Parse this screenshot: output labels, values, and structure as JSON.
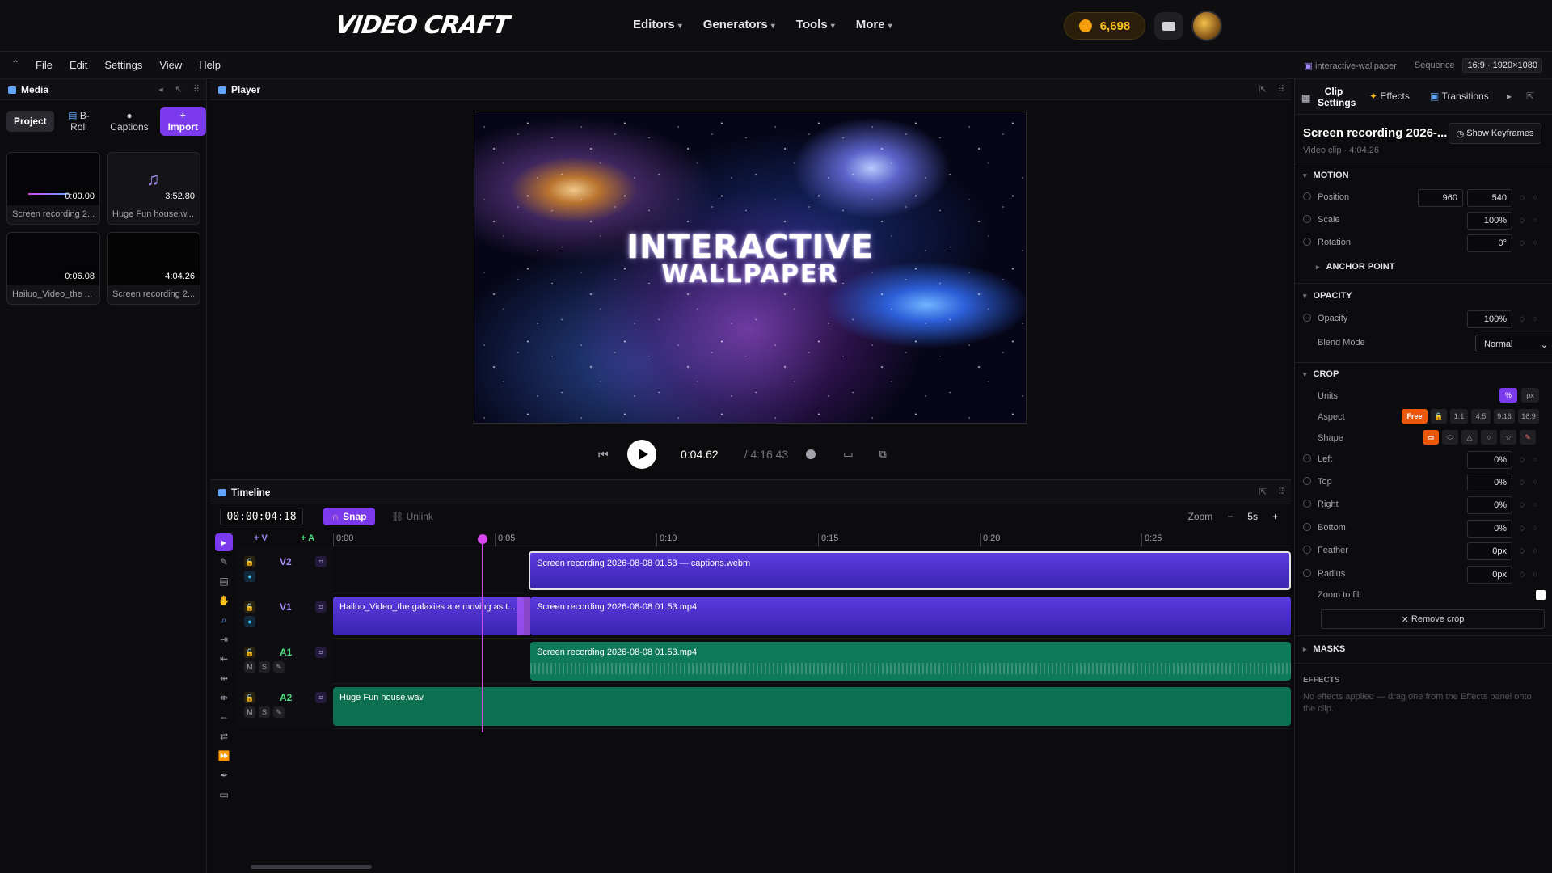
{
  "app": {
    "logo": "VIDEO CRAFT"
  },
  "topnav": [
    {
      "label": "Editors"
    },
    {
      "label": "Generators"
    },
    {
      "label": "Tools"
    },
    {
      "label": "More"
    }
  ],
  "coins": "6,698",
  "menubar": {
    "items": [
      "File",
      "Edit",
      "Settings",
      "View",
      "Help"
    ],
    "project": "interactive-wallpaper",
    "sequence_label": "Sequence",
    "sequence_value": "16:9 · 1920×1080"
  },
  "media": {
    "title": "Media",
    "tabs": {
      "project": "Project",
      "broll": "B-Roll",
      "captions": "Captions",
      "import": "Import"
    },
    "items": [
      {
        "name": "Screen recording 2...",
        "dur": "0:00.00"
      },
      {
        "name": "Huge Fun house.w...",
        "dur": "3:52.80"
      },
      {
        "name": "Hailuo_Video_the ...",
        "dur": "0:06.08"
      },
      {
        "name": "Screen recording 2...",
        "dur": "4:04.26"
      }
    ]
  },
  "player": {
    "title": "Player",
    "frame_line1": "INTERACTIVE",
    "frame_line2": "WALLPAPER",
    "current": "0:04.62",
    "total": "/ 4:16.43"
  },
  "timeline": {
    "title": "Timeline",
    "timecode": "00:00:04:18",
    "snap": "Snap",
    "unlink": "Unlink",
    "zoom_label": "Zoom",
    "zoom_minus": "−",
    "zoom_value": "5s",
    "zoom_plus": "+",
    "addv": "+ V",
    "adda": "+ A",
    "ruler": [
      "0:00",
      "0:05",
      "0:10",
      "0:15",
      "0:20",
      "0:25"
    ],
    "tracks": [
      {
        "name": "V2",
        "type": "video"
      },
      {
        "name": "V1",
        "type": "video"
      },
      {
        "name": "A1",
        "type": "audio"
      },
      {
        "name": "A2",
        "type": "audio"
      }
    ],
    "clips": {
      "v2": "Screen recording 2026-08-08 01.53 — captions.webm",
      "v1a": "Hailuo_Video_the galaxies are moving as t...",
      "v1b": "Screen recording 2026-08-08 01.53.mp4",
      "a1": "Screen recording 2026-08-08 01.53.mp4",
      "a2": "Huge Fun house.wav"
    },
    "mute": "M",
    "solo": "S"
  },
  "inspector": {
    "tabs": {
      "clip": "Clip Settings",
      "effects": "Effects",
      "transitions": "Transitions"
    },
    "clip_title": "Screen recording 2026-...",
    "clip_sub": "Video clip · 4:04.26",
    "show_keyframes": "Show Keyframes",
    "motion": {
      "title": "MOTION",
      "position": "Position",
      "pos_x": "960",
      "pos_y": "540",
      "scale": "Scale",
      "scale_v": "100%",
      "rotation": "Rotation",
      "rotation_v": "0°",
      "anchor": "ANCHOR POINT"
    },
    "opacity": {
      "title": "OPACITY",
      "opacity": "Opacity",
      "opacity_v": "100%",
      "blend": "Blend Mode",
      "blend_v": "Normal"
    },
    "crop": {
      "title": "CROP",
      "units": "Units",
      "unit_pct": "%",
      "unit_px": "px",
      "aspect": "Aspect",
      "aspect_opts": [
        "Free",
        "1:1",
        "4:5",
        "9:16",
        "16:9"
      ],
      "shape": "Shape",
      "left": "Left",
      "left_v": "0%",
      "top": "Top",
      "top_v": "0%",
      "right": "Right",
      "right_v": "0%",
      "bottom": "Bottom",
      "bottom_v": "0%",
      "feather": "Feather",
      "feather_v": "0px",
      "radius": "Radius",
      "radius_v": "0px",
      "zoom_fill": "Zoom to fill",
      "remove": "Remove crop"
    },
    "masks": {
      "title": "MASKS"
    },
    "effects": {
      "title": "EFFECTS",
      "empty": "No effects applied — drag one from the Effects panel onto the clip."
    }
  },
  "colors": {
    "accent": "#7c3aed",
    "playhead": "#d946ef",
    "audio": "#0f7a5a",
    "video": "#4b2fcf",
    "coin": "#fbbf24"
  }
}
